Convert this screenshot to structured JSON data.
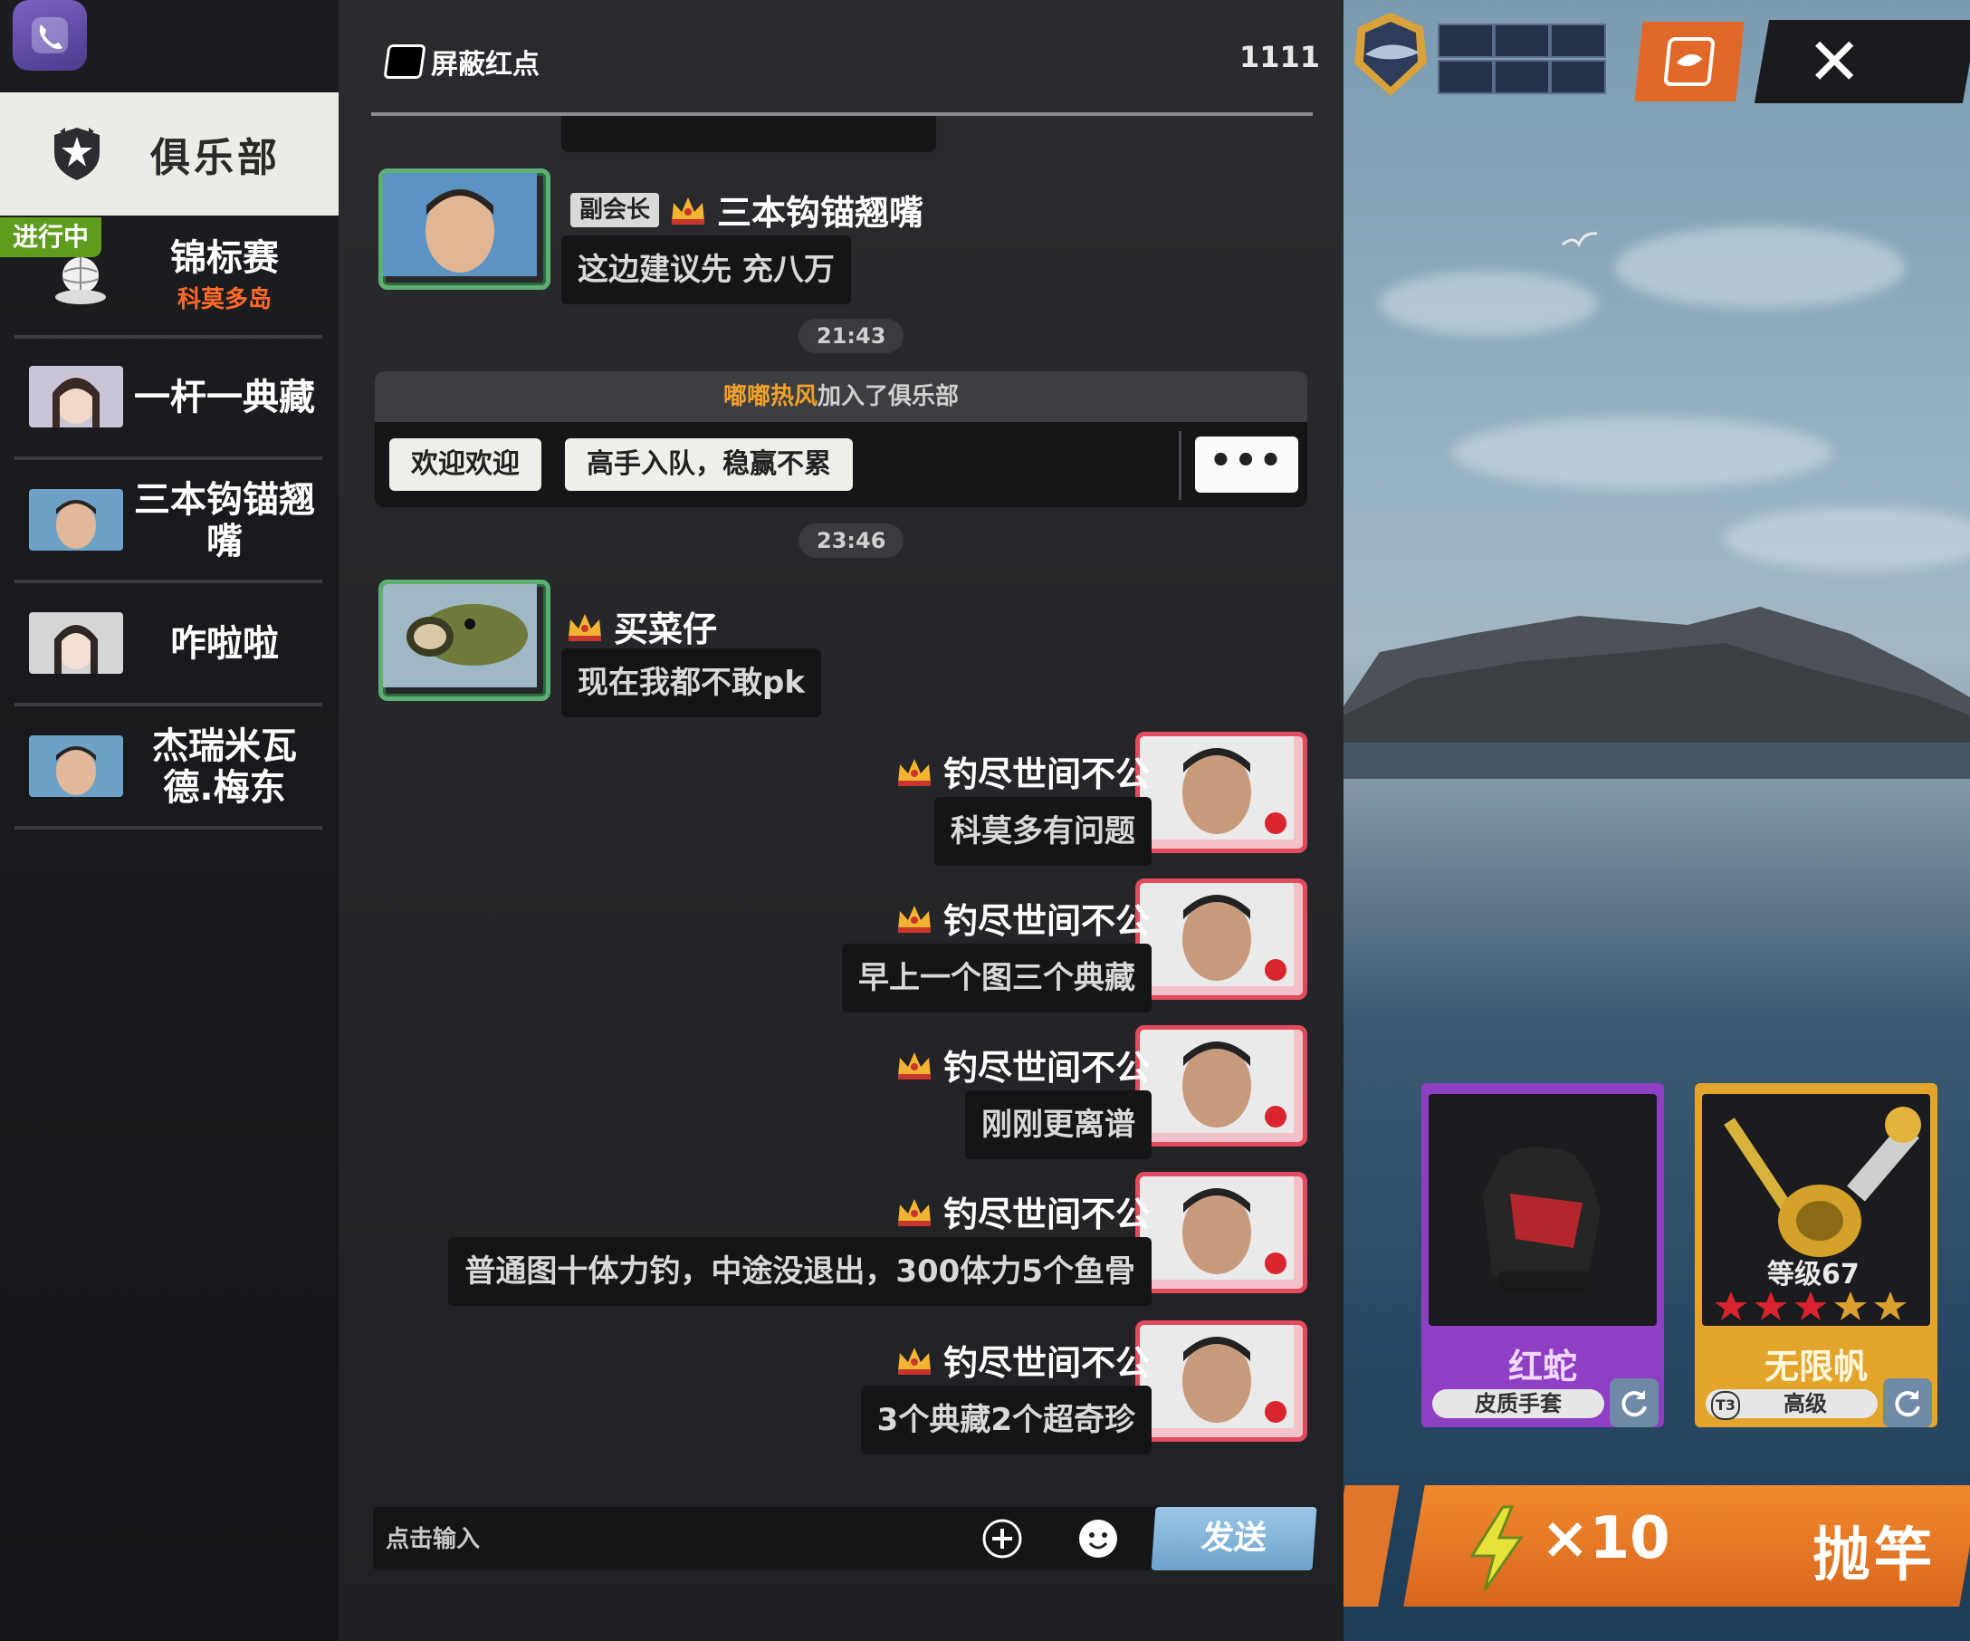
{
  "sidebar": {
    "club_label": "俱乐部",
    "tournament": {
      "badge": "进行中",
      "name": "锦标赛",
      "location": "科莫多岛"
    },
    "members": [
      {
        "name": "一杆一典藏"
      },
      {
        "name": "三本钩锚翘嘴"
      },
      {
        "name": "咋啦啦"
      },
      {
        "name": "杰瑞米瓦德.梅东"
      }
    ]
  },
  "chat": {
    "mute_label": "屏蔽红点",
    "online_count": "1111",
    "messages": [
      {
        "role": "副会长",
        "sender": "三本钩锚翘嘴",
        "text": "这边建议先 充八万"
      }
    ],
    "time_1": "21:43",
    "system": {
      "joined_name": "嘟嘟热风",
      "joined_text": "加入了俱乐部",
      "quick_1": "欢迎欢迎",
      "quick_2": "高手入队，稳赢不累",
      "more": "•••"
    },
    "time_2": "23:46",
    "msg2": {
      "sender": "买菜仔",
      "text": "现在我都不敢pk"
    },
    "self_sender": "钓尽世间不公",
    "self_messages": [
      "科莫多有问题",
      "早上一个图三个典藏",
      "刚刚更离谱",
      "普通图十体力钓，中途没退出，300体力5个鱼骨",
      "3个典藏2个超奇珍"
    ],
    "input_placeholder": "点击输入",
    "send_label": "发送"
  },
  "scene": {
    "close_label": "✕",
    "gear": [
      {
        "name": "红蛇",
        "sub": "皮质手套",
        "color": "#8e3fc4"
      },
      {
        "name": "无限帆",
        "sub": "高级",
        "level": "等级67",
        "tier": "T3",
        "color": "#e2a42a"
      }
    ],
    "energy": "×10",
    "cast_label": "抛竿"
  }
}
